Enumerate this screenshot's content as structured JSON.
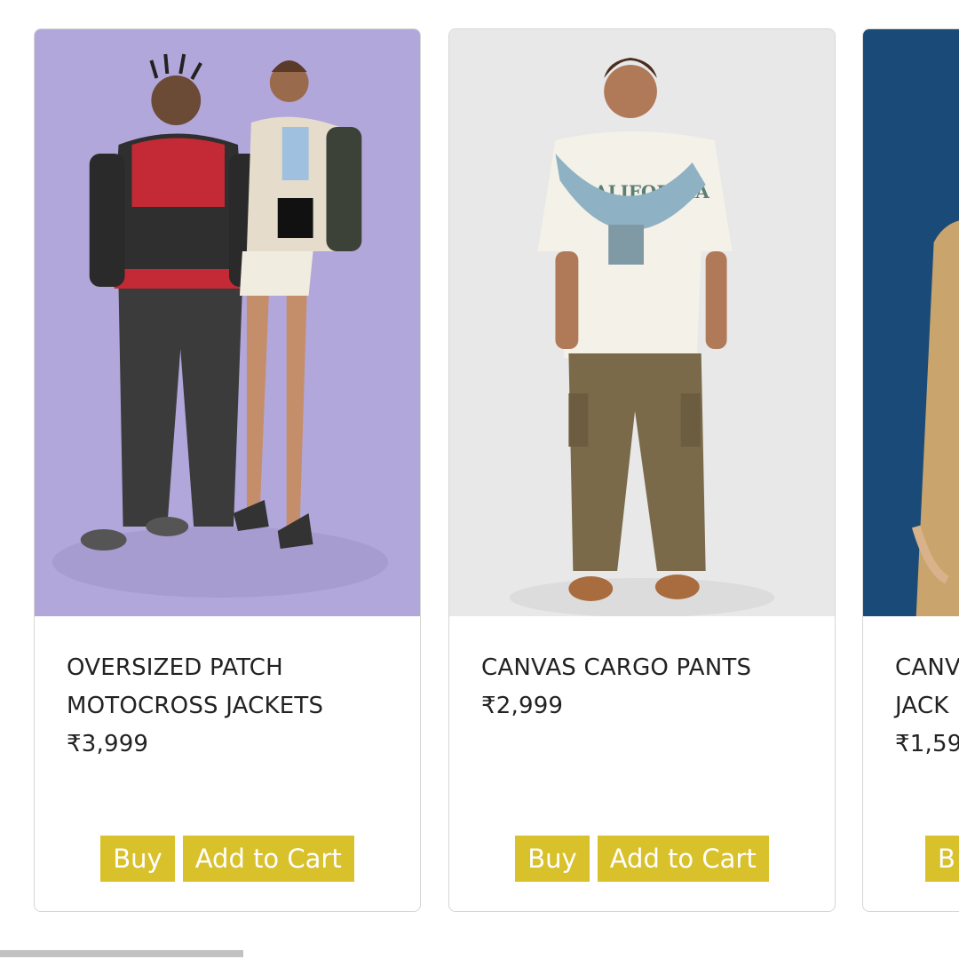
{
  "products": [
    {
      "title": "OVERSIZED PATCH MOTOCROSS JACKETS",
      "price": "₹3,999",
      "image_icon": "models-motocross-jacket-photo"
    },
    {
      "title": "CANVAS CARGO PANTS",
      "price": "₹2,999",
      "image_icon": "model-cargo-pants-photo"
    },
    {
      "title": "CANV",
      "title_line2": "JACK",
      "price": "₹1,59",
      "image_icon": "model-canvas-jacket-photo"
    }
  ],
  "buttons": {
    "buy_label": "Buy",
    "add_to_cart_label": "Add to Cart",
    "buy_label_partial": "B"
  },
  "colors": {
    "button_bg": "#d9c12c",
    "button_text": "#ffffff",
    "card_border": "#d6d6d6",
    "photo1_bg": "#b2a7da",
    "photo2_bg": "#e8e8e8",
    "photo3_bg": "#1a4b78"
  },
  "scroll": {
    "horizontal_position_fraction": 0.25
  }
}
